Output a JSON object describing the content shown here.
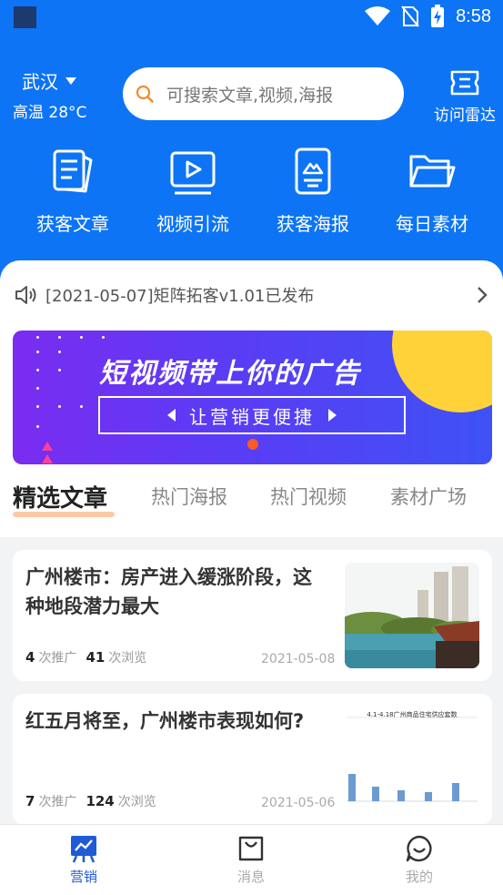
{
  "status_bar": {
    "time": "8:58"
  },
  "header": {
    "city": "武汉",
    "weather": "高温 28°C",
    "search_placeholder": "可搜索文章,视频,海报",
    "radar_label": "访问雷达"
  },
  "quick_actions": [
    {
      "label": "获客文章",
      "icon": "article-icon"
    },
    {
      "label": "视频引流",
      "icon": "video-icon"
    },
    {
      "label": "获客海报",
      "icon": "poster-icon"
    },
    {
      "label": "每日素材",
      "icon": "folder-icon"
    }
  ],
  "notice": {
    "text": "[2021-05-07]矩阵拓客v1.01已发布"
  },
  "banner": {
    "title": "短视频带上你的广告",
    "subtitle": "让营销更便捷"
  },
  "tabs": [
    {
      "label": "精选文章",
      "active": true
    },
    {
      "label": "热门海报",
      "active": false
    },
    {
      "label": "热门视频",
      "active": false
    },
    {
      "label": "素材广场",
      "active": false
    }
  ],
  "articles": [
    {
      "title": "广州楼市：房产进入缓涨阶段，这种地段潜力最大",
      "promote_count": "4",
      "promote_label": "次推广",
      "view_count": "41",
      "view_label": "次浏览",
      "date": "2021-05-08"
    },
    {
      "title": "红五月将至，广州楼市表现如何?",
      "promote_count": "7",
      "promote_label": "次推广",
      "view_count": "124",
      "view_label": "次浏览",
      "date": "2021-05-06",
      "thumb_caption": "4.1-4.18广州商品住宅供应套数"
    }
  ],
  "bottom_nav": [
    {
      "label": "营销",
      "active": true
    },
    {
      "label": "消息",
      "active": false
    },
    {
      "label": "我的",
      "active": false
    }
  ],
  "colors": {
    "primary": "#0d74f5",
    "active_nav": "#1f5bd6",
    "inactive": "#aaaaaa"
  }
}
